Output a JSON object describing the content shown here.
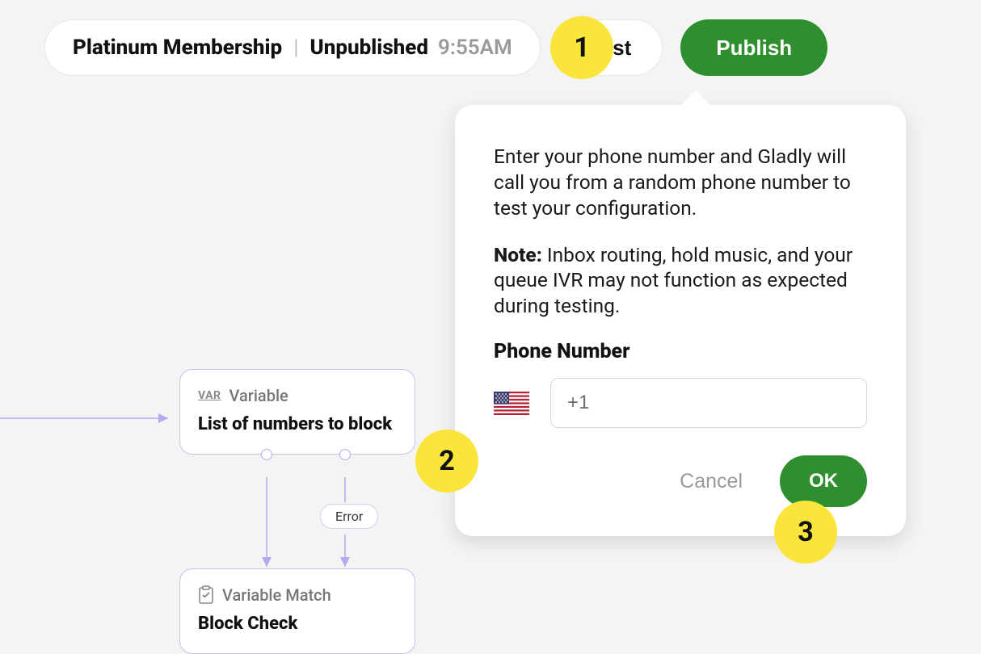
{
  "header": {
    "title": "Platinum Membership",
    "status": "Unpublished",
    "time": "9:55AM",
    "test_label": "Test",
    "publish_label": "Publish"
  },
  "annotations": {
    "one": "1",
    "two": "2",
    "three": "3"
  },
  "popover": {
    "intro": "Enter your phone number and Gladly will call you from a random phone number to test your configuration.",
    "note_prefix": "Note:",
    "note_body": " Inbox routing, hold music, and your queue IVR may not function as expected during testing.",
    "phone_label": "Phone Number",
    "phone_value": "+1",
    "cancel_label": "Cancel",
    "ok_label": "OK",
    "flag_country": "US"
  },
  "flow": {
    "variable_node": {
      "type_tag": "VAR",
      "type_label": "Variable",
      "title": "List of numbers to block"
    },
    "error_chip": "Error",
    "variable_match_node": {
      "type_label": "Variable Match",
      "title": "Block Check"
    }
  }
}
